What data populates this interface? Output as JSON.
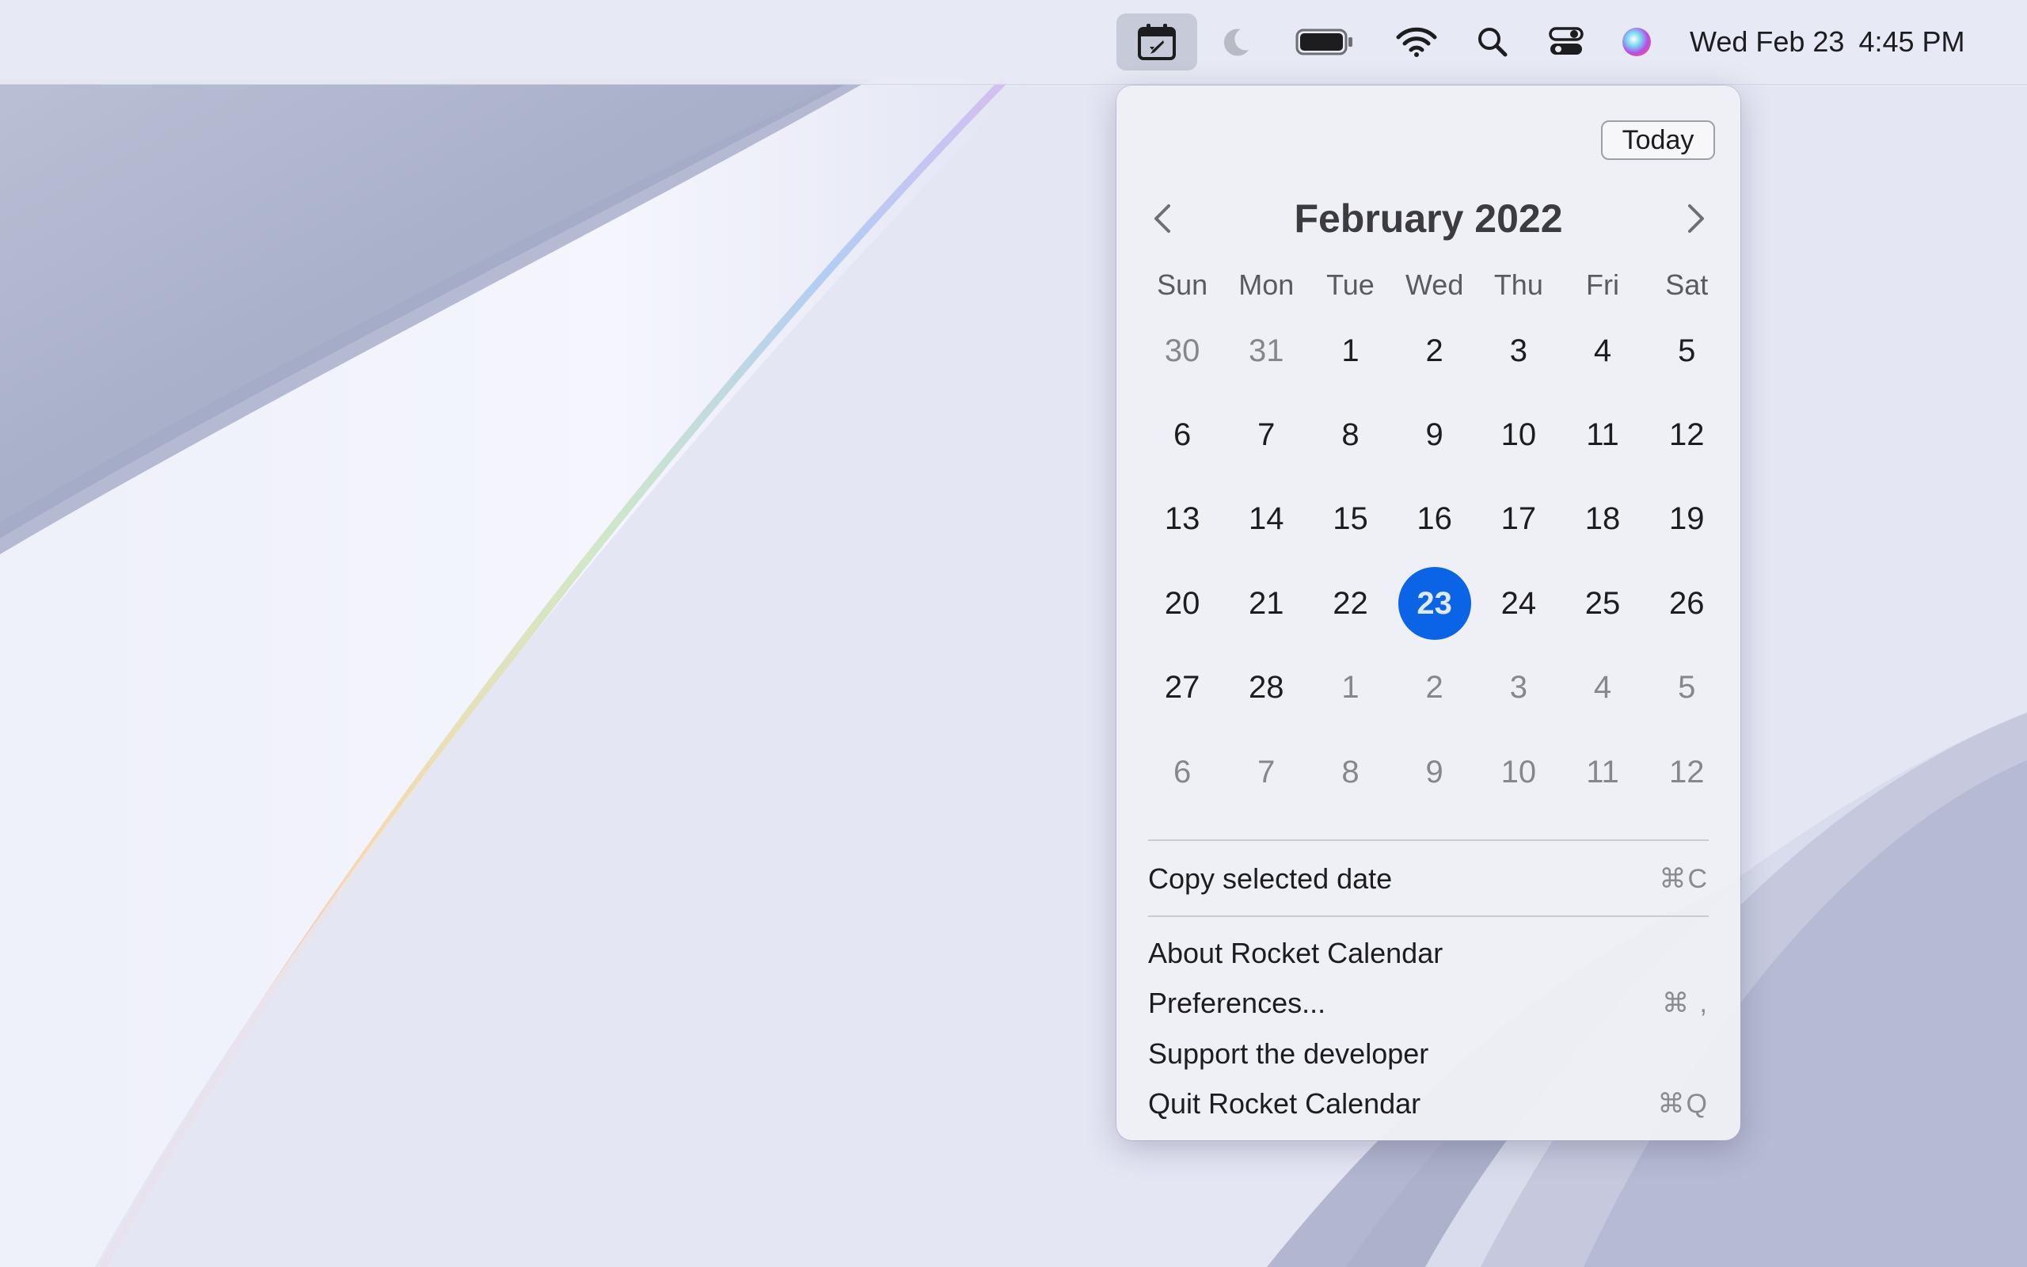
{
  "menubar": {
    "clock_date": "Wed Feb 23",
    "clock_time": "4:45 PM",
    "icons": [
      "rocket-calendar-icon",
      "moon-icon",
      "battery-icon",
      "wifi-icon",
      "search-icon",
      "control-center-icon",
      "siri-icon"
    ]
  },
  "calendar": {
    "today_label": "Today",
    "month_title": "February 2022",
    "weekdays": [
      "Sun",
      "Mon",
      "Tue",
      "Wed",
      "Thu",
      "Fri",
      "Sat"
    ],
    "weeks": [
      [
        {
          "d": "30",
          "m": true
        },
        {
          "d": "31",
          "m": true
        },
        {
          "d": "1"
        },
        {
          "d": "2"
        },
        {
          "d": "3"
        },
        {
          "d": "4"
        },
        {
          "d": "5"
        }
      ],
      [
        {
          "d": "6"
        },
        {
          "d": "7"
        },
        {
          "d": "8"
        },
        {
          "d": "9"
        },
        {
          "d": "10"
        },
        {
          "d": "11"
        },
        {
          "d": "12"
        }
      ],
      [
        {
          "d": "13"
        },
        {
          "d": "14"
        },
        {
          "d": "15"
        },
        {
          "d": "16"
        },
        {
          "d": "17"
        },
        {
          "d": "18"
        },
        {
          "d": "19"
        }
      ],
      [
        {
          "d": "20"
        },
        {
          "d": "21"
        },
        {
          "d": "22"
        },
        {
          "d": "23",
          "s": true
        },
        {
          "d": "24"
        },
        {
          "d": "25"
        },
        {
          "d": "26"
        }
      ],
      [
        {
          "d": "27"
        },
        {
          "d": "28"
        },
        {
          "d": "1",
          "m": true
        },
        {
          "d": "2",
          "m": true
        },
        {
          "d": "3",
          "m": true
        },
        {
          "d": "4",
          "m": true
        },
        {
          "d": "5",
          "m": true
        }
      ],
      [
        {
          "d": "6",
          "m": true
        },
        {
          "d": "7",
          "m": true
        },
        {
          "d": "8",
          "m": true
        },
        {
          "d": "9",
          "m": true
        },
        {
          "d": "10",
          "m": true
        },
        {
          "d": "11",
          "m": true
        },
        {
          "d": "12",
          "m": true
        }
      ]
    ],
    "selected_color": "#0b63e5"
  },
  "menu": {
    "copy_label": "Copy selected date",
    "copy_shortcut": "⌘C",
    "about_label": "About Rocket Calendar",
    "prefs_label": "Preferences...",
    "prefs_shortcut": "⌘ ,",
    "support_label": "Support the developer",
    "quit_label": "Quit Rocket Calendar",
    "quit_shortcut": "⌘Q"
  }
}
